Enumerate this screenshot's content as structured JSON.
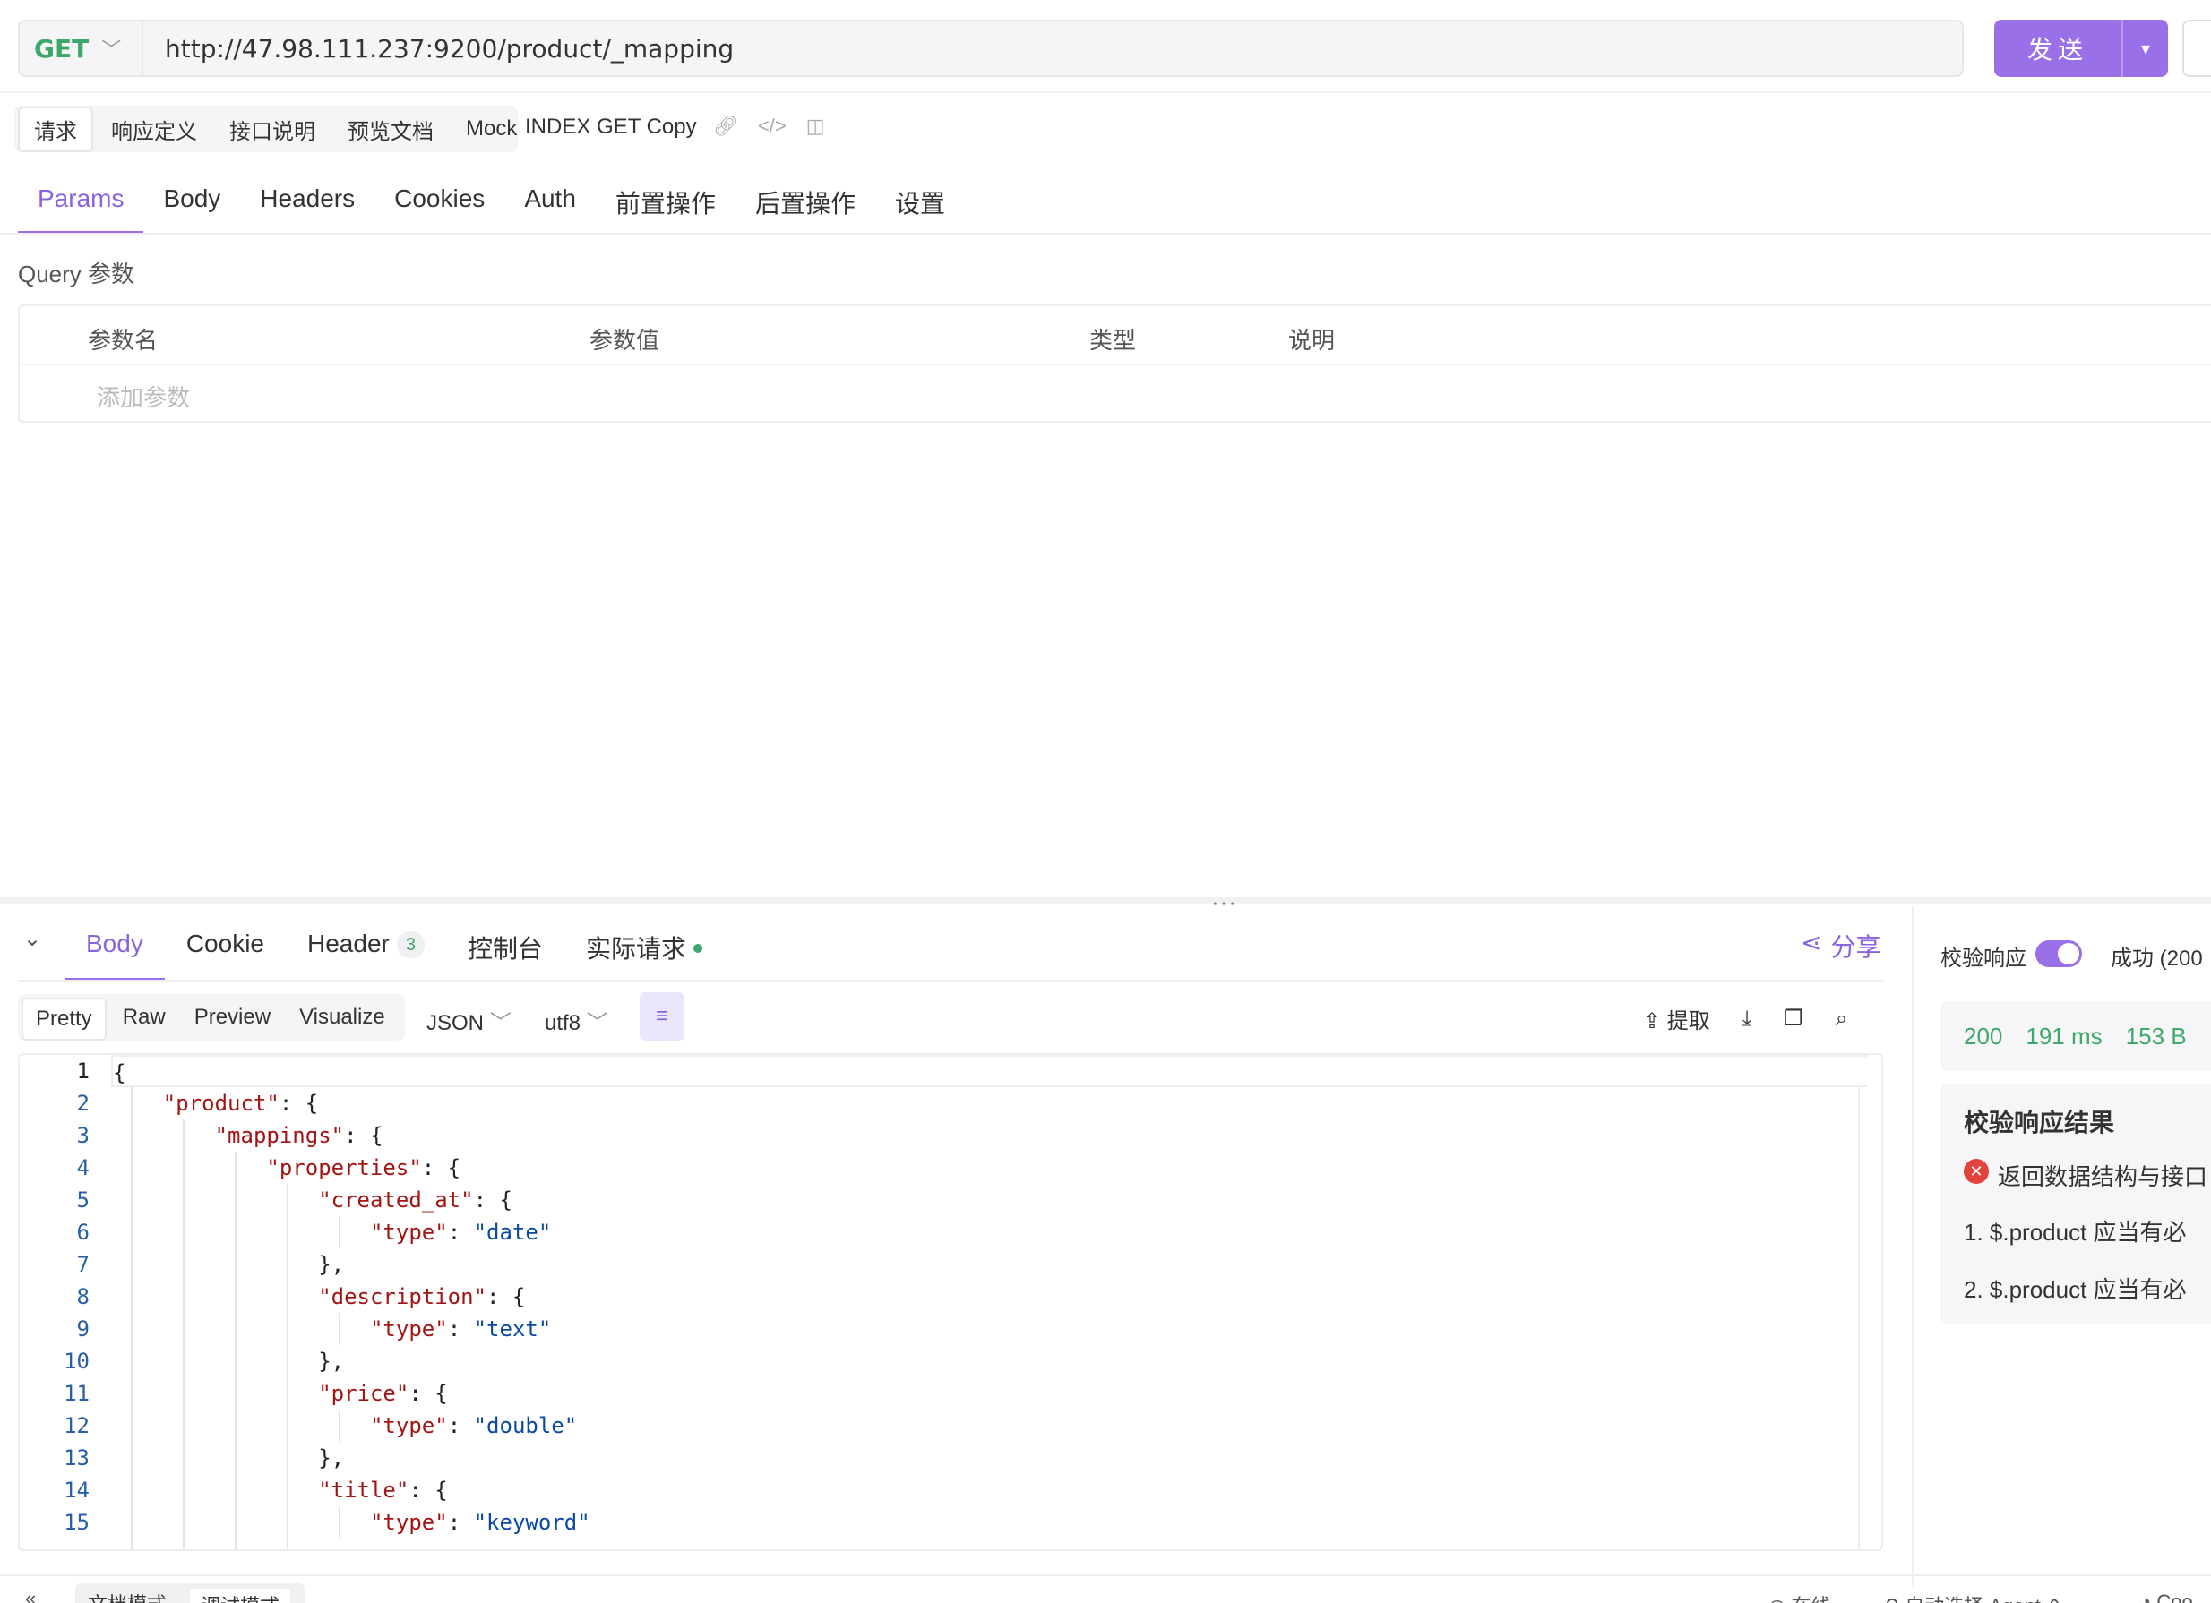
{
  "request": {
    "method": "GET",
    "url": "http://47.98.111.237:9200/product/_mapping",
    "send_label": "发送"
  },
  "subtabs": [
    "请求",
    "响应定义",
    "接口说明",
    "预览文档",
    "Mock"
  ],
  "api_name": "INDEX GET Copy",
  "main_tabs": [
    "Params",
    "Body",
    "Headers",
    "Cookies",
    "Auth",
    "前置操作",
    "后置操作",
    "设置"
  ],
  "query": {
    "label": "Query 参数",
    "headers": [
      "参数名",
      "参数值",
      "类型",
      "说明"
    ],
    "add_placeholder": "添加参数"
  },
  "response": {
    "tabs": [
      "Body",
      "Cookie",
      "Header",
      "控制台",
      "实际请求"
    ],
    "header_count": "3",
    "share_label": "分享",
    "formats": [
      "Pretty",
      "Raw",
      "Preview",
      "Visualize"
    ],
    "lang": "JSON",
    "encoding": "utf8",
    "extract_label": "提取",
    "code_lines": [
      {
        "n": "1",
        "indent": 0,
        "k": "",
        "sep": "{",
        "s": "",
        "tail": ""
      },
      {
        "n": "2",
        "indent": 1,
        "k": "\"product\"",
        "sep": ": {",
        "s": "",
        "tail": ""
      },
      {
        "n": "3",
        "indent": 2,
        "k": "\"mappings\"",
        "sep": ": {",
        "s": "",
        "tail": ""
      },
      {
        "n": "4",
        "indent": 3,
        "k": "\"properties\"",
        "sep": ": {",
        "s": "",
        "tail": ""
      },
      {
        "n": "5",
        "indent": 4,
        "k": "\"created_at\"",
        "sep": ": {",
        "s": "",
        "tail": ""
      },
      {
        "n": "6",
        "indent": 5,
        "k": "\"type\"",
        "sep": ": ",
        "s": "\"date\"",
        "tail": ""
      },
      {
        "n": "7",
        "indent": 4,
        "k": "",
        "sep": "},",
        "s": "",
        "tail": ""
      },
      {
        "n": "8",
        "indent": 4,
        "k": "\"description\"",
        "sep": ": {",
        "s": "",
        "tail": ""
      },
      {
        "n": "9",
        "indent": 5,
        "k": "\"type\"",
        "sep": ": ",
        "s": "\"text\"",
        "tail": ""
      },
      {
        "n": "10",
        "indent": 4,
        "k": "",
        "sep": "},",
        "s": "",
        "tail": ""
      },
      {
        "n": "11",
        "indent": 4,
        "k": "\"price\"",
        "sep": ": {",
        "s": "",
        "tail": ""
      },
      {
        "n": "12",
        "indent": 5,
        "k": "\"type\"",
        "sep": ": ",
        "s": "\"double\"",
        "tail": ""
      },
      {
        "n": "13",
        "indent": 4,
        "k": "",
        "sep": "},",
        "s": "",
        "tail": ""
      },
      {
        "n": "14",
        "indent": 4,
        "k": "\"title\"",
        "sep": ": {",
        "s": "",
        "tail": ""
      },
      {
        "n": "15",
        "indent": 5,
        "k": "\"type\"",
        "sep": ": ",
        "s": "\"keyword\"",
        "tail": ""
      }
    ]
  },
  "validation": {
    "label": "校验响应",
    "status": "成功 (200",
    "code": "200",
    "time": "191 ms",
    "size": "153 B",
    "result_title": "校验响应结果",
    "error_text": "返回数据结构与接口",
    "items": [
      "1. $.product 应当有必",
      "2. $.product 应当有必"
    ]
  },
  "bottom": {
    "modes": [
      "文档模式",
      "调试模式"
    ],
    "online": "在线",
    "agent": "自动选择 Agent",
    "cookie": "Coo"
  },
  "colors": {
    "accent": "#9a70e8",
    "method_get": "#3ea86b",
    "json_key": "#a31515",
    "json_string": "#0b4aa2"
  }
}
